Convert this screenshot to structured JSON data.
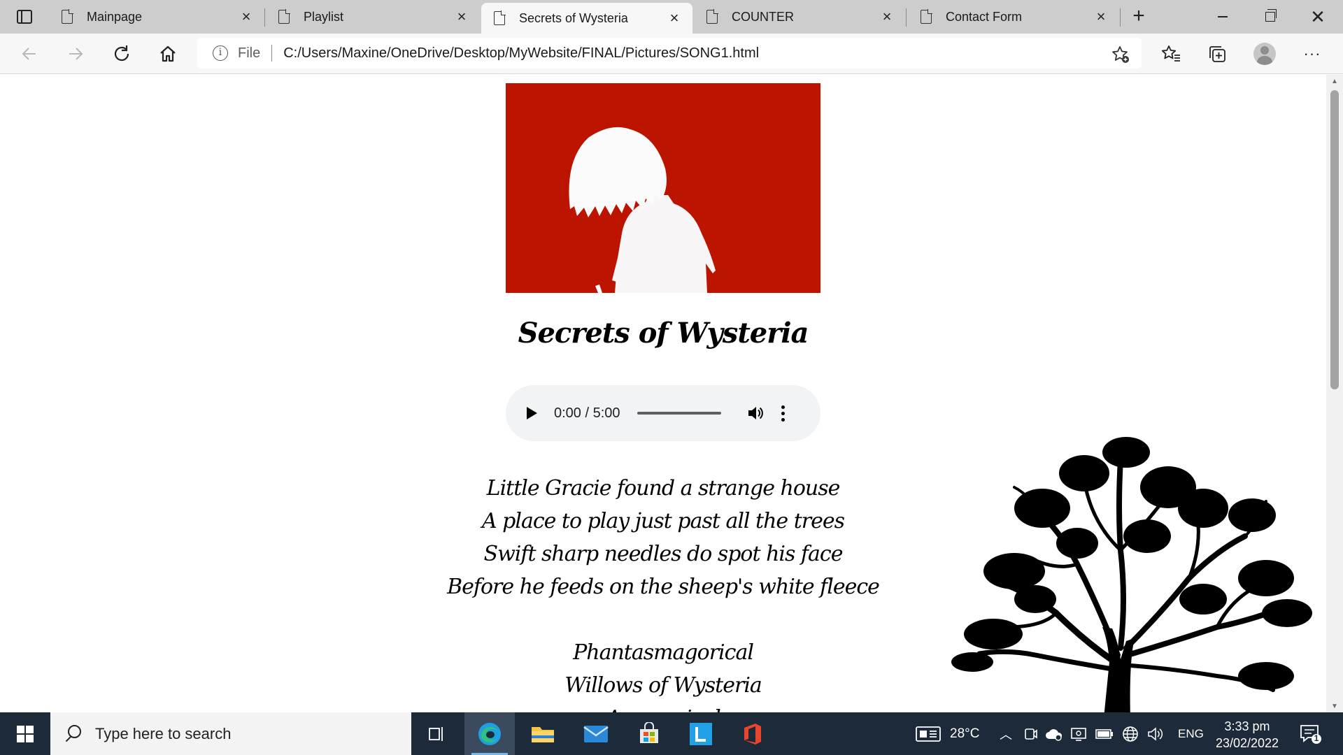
{
  "browser": {
    "tabs": [
      {
        "title": "Mainpage",
        "active": false
      },
      {
        "title": "Playlist",
        "active": false
      },
      {
        "title": "Secrets of Wysteria",
        "active": true
      },
      {
        "title": "COUNTER",
        "active": false
      },
      {
        "title": "Contact Form",
        "active": false
      }
    ],
    "address": {
      "scheme_label": "File",
      "url": "C:/Users/Maxine/OneDrive/Desktop/MyWebsite/FINAL/Pictures/SONG1.html"
    }
  },
  "page": {
    "song_title": "Secrets of Wysteria",
    "player": {
      "time": "0:00 / 5:00",
      "progress": 0
    },
    "lyrics": [
      "Little Gracie found a strange house",
      "A place to play just past all the trees",
      "Swift sharp needles do spot his face",
      "Before he feeds on the sheep's white fleece",
      "",
      "Phantasmagorical",
      "Willows of Wysteria",
      "Amagorical"
    ],
    "colors": {
      "cover_background": "#bd1400",
      "player_background": "#f1f3f4"
    }
  },
  "taskbar": {
    "search_placeholder": "Type here to search",
    "weather": "28°C",
    "language": "ENG",
    "time": "3:33 pm",
    "date": "23/02/2022",
    "notification_count": "1",
    "pinned_apps": [
      "task-view",
      "edge",
      "file-explorer",
      "mail",
      "microsoft-store",
      "l-app",
      "office"
    ]
  }
}
